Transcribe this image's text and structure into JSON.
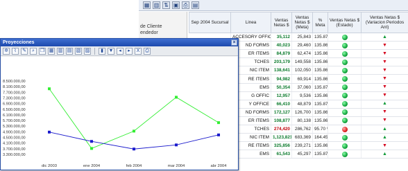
{
  "bg_toolbar": {
    "icons": [
      "grid-icon",
      "chart-icon",
      "pivot-icon",
      "save-icon",
      "print-icon",
      "table-icon"
    ]
  },
  "filter_panel": {
    "line1": "de Cliente",
    "line2": "endedor"
  },
  "grid": {
    "headers": {
      "sucursal": "Sep 2004 Sucursal",
      "linea": "Linea",
      "netas": "Ventas Netas $",
      "meta": "Ventas Netas $ (Meta)",
      "pct": "% Meta",
      "estado": "Ventas Netas $ (Estado)",
      "variacion": "Ventas Netas $ (Variacion Periodos Ant)"
    },
    "rows": [
      {
        "linea": "ACCESORY OFFICE",
        "netas": "35,112",
        "meta": "25,843",
        "pct": "135.87 %",
        "estado": "green",
        "trend": "up"
      },
      {
        "linea": "ND FORMS",
        "netas": "40,023",
        "meta": "29,460",
        "pct": "135.86 %",
        "estado": "green",
        "trend": "down"
      },
      {
        "linea": "ER ITEMS",
        "netas": "84,879",
        "meta": "62,474",
        "pct": "135.86 %",
        "estado": "green",
        "trend": "down"
      },
      {
        "linea": "TCHES",
        "netas": "203,179",
        "meta": "149,558",
        "pct": "135.86 %",
        "estado": "green",
        "trend": "down"
      },
      {
        "linea": "NIC ITEM",
        "netas": "138,641",
        "meta": "102,050",
        "pct": "135.86 %",
        "estado": "green",
        "trend": "down"
      },
      {
        "linea": "RE ITEMS",
        "netas": "94,982",
        "meta": "69,914",
        "pct": "135.86 %",
        "estado": "green",
        "trend": "down"
      },
      {
        "linea": "EMS",
        "netas": "50,354",
        "meta": "37,060",
        "pct": "135.87 %",
        "estado": "green",
        "trend": "down"
      },
      {
        "linea": "G OFFIC",
        "netas": "12,957",
        "meta": "9,536",
        "pct": "135.86 %",
        "estado": "green",
        "trend": "down"
      },
      {
        "linea": "Y OFFICE",
        "netas": "66,410",
        "meta": "48,879",
        "pct": "135.87 %",
        "estado": "green",
        "trend": "up"
      },
      {
        "linea": "ND FORMS",
        "netas": "172,127",
        "meta": "126,700",
        "pct": "135.86 %",
        "estado": "green",
        "trend": "down"
      },
      {
        "linea": "ER ITEMS",
        "netas": "108,877",
        "meta": "80,138",
        "pct": "135.86 %",
        "estado": "green",
        "trend": "down"
      },
      {
        "linea": "TCHES",
        "netas": "274,420",
        "meta": "286,762",
        "pct": "95.70 %",
        "estado": "red",
        "trend": "up",
        "negative": true
      },
      {
        "linea": "NIC ITEM",
        "netas": "1,123,821",
        "meta": "683,369",
        "pct": "164.45 %",
        "estado": "green",
        "trend": "up"
      },
      {
        "linea": "RE ITEMS",
        "netas": "325,856",
        "meta": "239,271",
        "pct": "135.86 %",
        "estado": "green",
        "trend": "down"
      },
      {
        "linea": "EMS",
        "netas": "61,543",
        "meta": "45,297",
        "pct": "135.87 %",
        "estado": "green",
        "trend": "up"
      }
    ]
  },
  "window": {
    "title": "Proyecciones",
    "close_label": "×"
  },
  "chart_data": {
    "type": "line",
    "categories": [
      "dic 2003",
      "ene 2004",
      "feb 2004",
      "mar 2004",
      "abr 2004"
    ],
    "series": [
      {
        "color": "#33ee33",
        "values": [
          7950000,
          3720000,
          4950000,
          7350000,
          5550000
        ]
      },
      {
        "color": "#1a1acc",
        "values": [
          4880000,
          4220000,
          3680000,
          3970000,
          4680000
        ]
      }
    ],
    "yticks": [
      "3.300.000,00",
      "3.700.000,00",
      "4.100.000,00",
      "4.500.000,00",
      "4.900.000,00",
      "5.300.000,00",
      "5.700.000,00",
      "6.100.000,00",
      "6.500.000,00",
      "6.900.000,00",
      "7.300.000,00",
      "7.700.000,00",
      "8.100.000,00",
      "8.500.000,00"
    ],
    "ylim": [
      3300000,
      8500000
    ],
    "grid": false,
    "legend": "none"
  }
}
